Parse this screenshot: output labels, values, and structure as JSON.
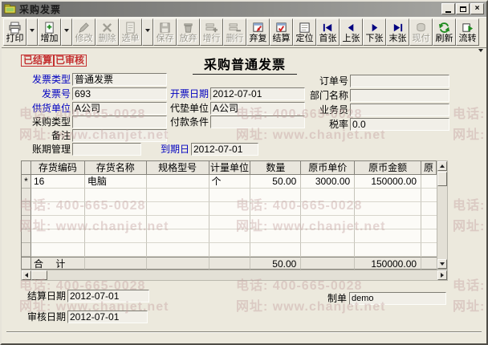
{
  "window": {
    "title": "采购发票"
  },
  "toolbar": {
    "buttons": [
      {
        "label": "打印",
        "enabled": true,
        "dropdown": true
      },
      {
        "label": "增加",
        "enabled": true,
        "dropdown": true
      },
      {
        "label": "修改",
        "enabled": false,
        "dropdown": false
      },
      {
        "label": "删除",
        "enabled": false,
        "dropdown": false
      },
      {
        "label": "选单",
        "enabled": false,
        "dropdown": true
      },
      {
        "label": "保存",
        "enabled": false,
        "dropdown": false
      },
      {
        "label": "放弃",
        "enabled": false,
        "dropdown": false
      },
      {
        "label": "增行",
        "enabled": false,
        "dropdown": false
      },
      {
        "label": "删行",
        "enabled": false,
        "dropdown": false
      },
      {
        "label": "弃复",
        "enabled": true,
        "dropdown": false
      },
      {
        "label": "结算",
        "enabled": true,
        "dropdown": false
      },
      {
        "label": "定位",
        "enabled": true,
        "dropdown": false
      },
      {
        "label": "首张",
        "enabled": true,
        "dropdown": false
      },
      {
        "label": "上张",
        "enabled": true,
        "dropdown": false
      },
      {
        "label": "下张",
        "enabled": true,
        "dropdown": false
      },
      {
        "label": "末张",
        "enabled": true,
        "dropdown": false
      },
      {
        "label": "现付",
        "enabled": false,
        "dropdown": false
      },
      {
        "label": "刷新",
        "enabled": true,
        "dropdown": false
      },
      {
        "label": "流转",
        "enabled": true,
        "dropdown": false
      }
    ]
  },
  "stamps": {
    "settled": "已结算",
    "audited": "已审核"
  },
  "doc": {
    "title": "采购普通发票"
  },
  "form": {
    "fields": [
      {
        "label": "发票类型",
        "value": "普通发票"
      },
      {
        "label": "订单号",
        "value": ""
      },
      {
        "label": "发票号",
        "value": "693"
      },
      {
        "label": "开票日期",
        "value": "2012-07-01"
      },
      {
        "label": "部门名称",
        "value": ""
      },
      {
        "label": "供货单位",
        "value": "A公司"
      },
      {
        "label": "代垫单位",
        "value": "A公司"
      },
      {
        "label": "业务员",
        "value": ""
      },
      {
        "label": "采购类型",
        "value": ""
      },
      {
        "label": "付款条件",
        "value": ""
      },
      {
        "label": "税率",
        "value": "0.0"
      },
      {
        "label": "备注",
        "value": ""
      },
      {
        "label": "账期管理",
        "value": ""
      },
      {
        "label": "到期日",
        "value": "2012-07-01"
      }
    ]
  },
  "table": {
    "headers": [
      "存货编码",
      "存货名称",
      "规格型号",
      "计量单位",
      "数量",
      "原币单价",
      "原币金额",
      "原"
    ],
    "rows": [
      {
        "marker": "*",
        "code": "16",
        "name": "电脑",
        "spec": "",
        "unit": "个",
        "qty": "50.00",
        "price": "3000.00",
        "amount": "150000.00"
      }
    ],
    "total": {
      "label": "合  计",
      "qty": "50.00",
      "amount": "150000.00"
    }
  },
  "footer": {
    "settle_date": {
      "label": "结算日期",
      "value": "2012-07-01"
    },
    "maker": {
      "label": "制单",
      "value": "demo"
    },
    "audit_date": {
      "label": "审核日期",
      "value": "2012-07-01"
    }
  },
  "watermark": {
    "phone": "电话: 400-665-0028",
    "site": "网址: www.chanjet.net"
  },
  "colors": {
    "label_blue": "#0000c0",
    "stamp_red": "#c43030",
    "nav_navy": "#000080"
  }
}
